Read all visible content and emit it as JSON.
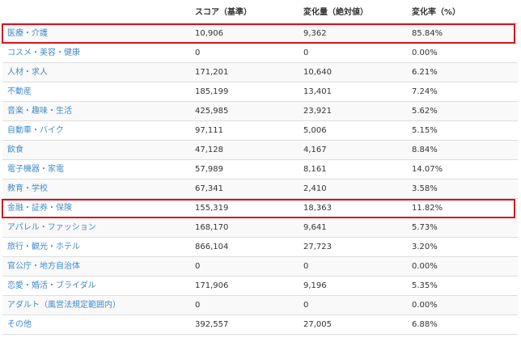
{
  "table": {
    "headers": [
      "",
      "スコア（基準）",
      "変化量（絶対値）",
      "変化率（%）"
    ],
    "rows": [
      {
        "category": "医療・介護",
        "score": "10,906",
        "change": "9,362",
        "rate": "85.84%",
        "highlighted": true
      },
      {
        "category": "コスメ・美容・健康",
        "score": "0",
        "change": "0",
        "rate": "0.00%",
        "highlighted": false
      },
      {
        "category": "人材・求人",
        "score": "171,201",
        "change": "10,640",
        "rate": "6.21%",
        "highlighted": false
      },
      {
        "category": "不動産",
        "score": "185,199",
        "change": "13,401",
        "rate": "7.24%",
        "highlighted": false
      },
      {
        "category": "音楽・趣味・生活",
        "score": "425,985",
        "change": "23,921",
        "rate": "5.62%",
        "highlighted": false
      },
      {
        "category": "自動車・バイク",
        "score": "97,111",
        "change": "5,006",
        "rate": "5.15%",
        "highlighted": false
      },
      {
        "category": "飲食",
        "score": "47,128",
        "change": "4,167",
        "rate": "8.84%",
        "highlighted": false
      },
      {
        "category": "電子機器・家電",
        "score": "57,989",
        "change": "8,161",
        "rate": "14.07%",
        "highlighted": false
      },
      {
        "category": "教育・学校",
        "score": "67,341",
        "change": "2,410",
        "rate": "3.58%",
        "highlighted": false
      },
      {
        "category": "金融・証券・保険",
        "score": "155,319",
        "change": "18,363",
        "rate": "11.82%",
        "highlighted": true
      },
      {
        "category": "アパレル・ファッション",
        "score": "168,170",
        "change": "9,641",
        "rate": "5.73%",
        "highlighted": false
      },
      {
        "category": "旅行・観光・ホテル",
        "score": "866,104",
        "change": "27,723",
        "rate": "3.20%",
        "highlighted": false
      },
      {
        "category": "官公庁・地方自治体",
        "score": "0",
        "change": "0",
        "rate": "0.00%",
        "highlighted": false
      },
      {
        "category": "恋愛・婚活・ブライダル",
        "score": "171,906",
        "change": "9,196",
        "rate": "5.35%",
        "highlighted": false
      },
      {
        "category": "アダルト（風営法規定範囲内）",
        "score": "0",
        "change": "0",
        "rate": "0.00%",
        "highlighted": false
      },
      {
        "category": "その他",
        "score": "392,557",
        "change": "27,005",
        "rate": "6.88%",
        "highlighted": false
      }
    ]
  },
  "colors": {
    "link": "#428bca",
    "highlight_border": "#d9131b",
    "row_stripe": "#f9f9f9",
    "grid_line": "#dddddd"
  }
}
